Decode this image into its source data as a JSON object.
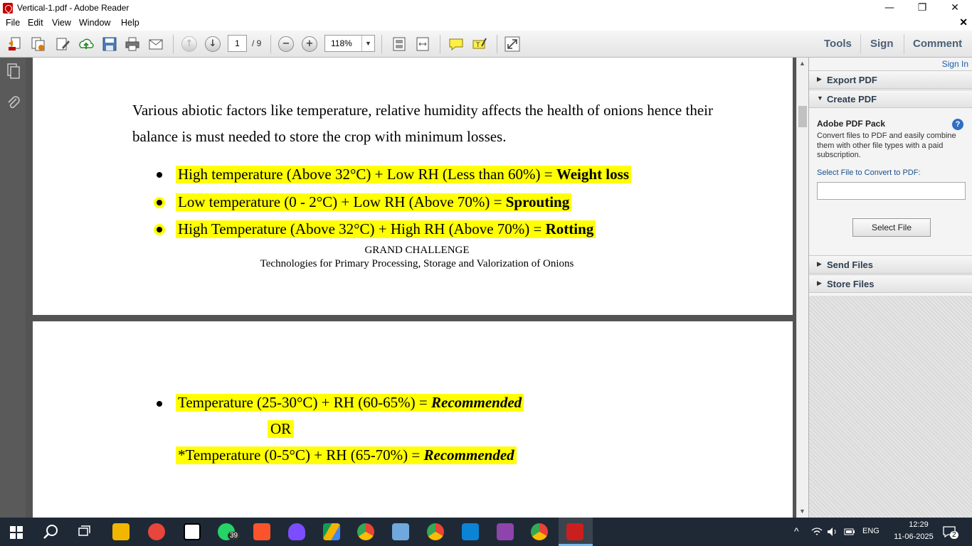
{
  "window": {
    "title": "Vertical-1.pdf - Adobe Reader",
    "minimize_glyph": "—",
    "maximize_glyph": "❐",
    "close_glyph": "✕"
  },
  "menu": {
    "items": [
      "File",
      "Edit",
      "View",
      "Window",
      "Help"
    ],
    "close_doc_glyph": "✕"
  },
  "toolbar": {
    "current_page": "1",
    "total_pages": "/ 9",
    "zoom": "118%",
    "zoom_minus": "−",
    "zoom_plus": "+",
    "prev_glyph": "↑",
    "next_glyph": "↓",
    "dropdown_glyph": "▼",
    "tools_label": "Tools",
    "sign_label": "Sign",
    "comment_label": "Comment"
  },
  "document": {
    "page1": {
      "paragraph": "Various abiotic factors like temperature, relative humidity affects the health of onions hence their balance is must needed to store the crop with minimum losses.",
      "bullets": [
        {
          "text": "High temperature (Above 32°C) + Low RH (Less than 60%) = ",
          "result": "Weight loss"
        },
        {
          "text": "Low temperature (0 - 2°C) + Low RH (Above 70%) = ",
          "result": "Sprouting"
        },
        {
          "text": "High Temperature (Above 32°C) + High RH (Above 70%) = ",
          "result": "Rotting"
        }
      ],
      "footer_line1": "GRAND CHALLENGE",
      "footer_line2": "Technologies for Primary Processing, Storage and Valorization of Onions"
    },
    "page2": {
      "rec1_text": "Temperature (25-30°C) + RH (60-65%) = ",
      "rec1_result": "Recommended",
      "or_text": "OR",
      "rec2_text": "*Temperature (0-5°C) + RH (65-70%) = ",
      "rec2_result": "Recommended"
    }
  },
  "right_pane": {
    "sign_in": "Sign In",
    "export_pdf": "Export PDF",
    "create_pdf": "Create PDF",
    "pack_title": "Adobe PDF Pack",
    "pack_desc": "Convert files to PDF and easily combine them with other file types with a paid subscription.",
    "select_label": "Select File to Convert to PDF:",
    "select_button": "Select File",
    "send_files": "Send Files",
    "store_files": "Store Files",
    "help_glyph": "?",
    "collapsed_glyph": "▶",
    "expanded_glyph": "▼"
  },
  "taskbar": {
    "whatsapp_badge": "39",
    "language": "ENG",
    "time": "12:29",
    "date": "11-06-2025",
    "notifications": "2",
    "tray_chevron": "^"
  },
  "colors": {
    "highlight": "#ffff00",
    "doc_background": "#535353",
    "taskbar": "#1f2936",
    "link_blue": "#1b5fa8"
  },
  "icons": [
    "pdf-app-icon",
    "create-pdf-icon",
    "edit-pdf-icon",
    "upload-icon",
    "save-icon",
    "print-icon",
    "email-icon",
    "sticky-note-icon",
    "highlight-icon",
    "fullscreen-icon",
    "pages-panel-icon",
    "attachment-icon",
    "windows-start-icon",
    "search-icon",
    "task-view-icon"
  ]
}
